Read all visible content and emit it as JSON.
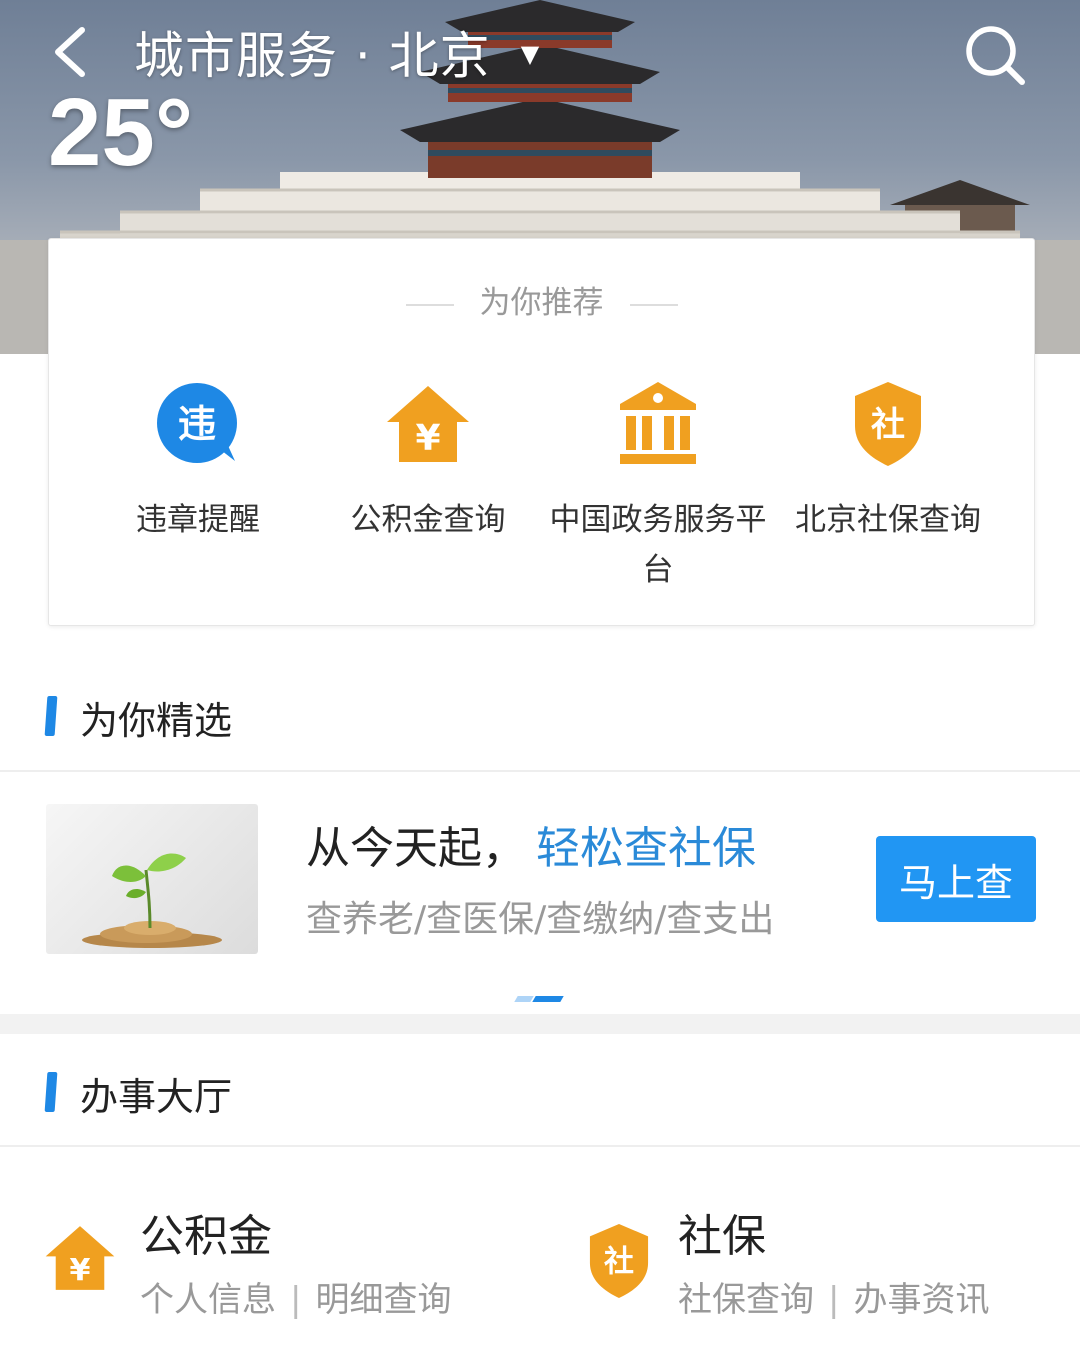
{
  "header": {
    "title": "城市服务 · 北京",
    "temperature": "25°"
  },
  "recommend": {
    "title": "为你推荐",
    "items": [
      {
        "label": "违章提醒",
        "icon": "violation-icon",
        "icon_text": "违",
        "color": "#1e88e5"
      },
      {
        "label": "公积金查询",
        "icon": "housing-fund-icon",
        "icon_text": "¥",
        "color": "#f0a020"
      },
      {
        "label": "中国政务服务平台",
        "icon": "government-building-icon",
        "icon_text": "",
        "color": "#f0a020"
      },
      {
        "label": "北京社保查询",
        "icon": "social-security-icon",
        "icon_text": "社",
        "color": "#f0a020"
      }
    ]
  },
  "featured": {
    "title": "为你精选",
    "banner": {
      "headline": "从今天起，",
      "highlight": "轻松查社保",
      "subtitle": "查养老/查医保/查缴纳/查支出",
      "button": "马上查"
    }
  },
  "hall": {
    "title": "办事大厅",
    "items": [
      {
        "title": "公积金",
        "link1": "个人信息",
        "link2": "明细查询",
        "separator": "|",
        "icon": "housing-fund-icon",
        "icon_text": "¥"
      },
      {
        "title": "社保",
        "link1": "社保查询",
        "link2": "办事资讯",
        "separator": "|",
        "icon": "social-security-icon",
        "icon_text": "社"
      }
    ]
  },
  "colors": {
    "accent": "#1e88e5",
    "orange": "#f0a020",
    "button": "#2196f3"
  }
}
